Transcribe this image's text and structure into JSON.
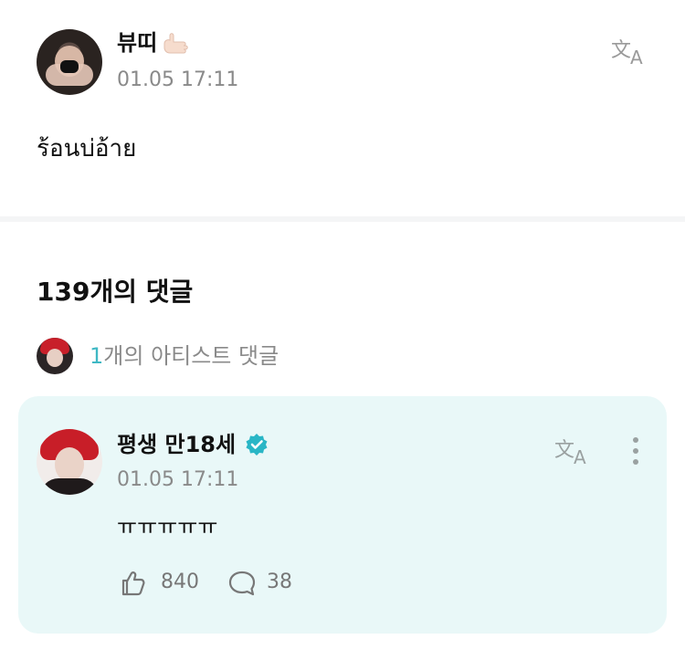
{
  "post": {
    "author_name": "뷰띠",
    "timestamp": "01.05 17:11",
    "body": "ร้อนบ่อ้าย",
    "icons": {
      "emoji": "thumb-pinky-hand-emoji",
      "translate": "translate-icon"
    }
  },
  "comments": {
    "count_label": "139개의 댓글",
    "artist_comments": {
      "number": "1",
      "label": "개의 아티스트 댓글"
    }
  },
  "artist_comment": {
    "name": "평생 만18세",
    "timestamp": "01.05 17:11",
    "text": "ㅠㅠㅠㅠㅠ",
    "likes": "840",
    "replies": "38",
    "colors": {
      "card_bg": "#e9f8f8",
      "verified": "#29b6c6",
      "accent": "#3fb8c4"
    }
  }
}
